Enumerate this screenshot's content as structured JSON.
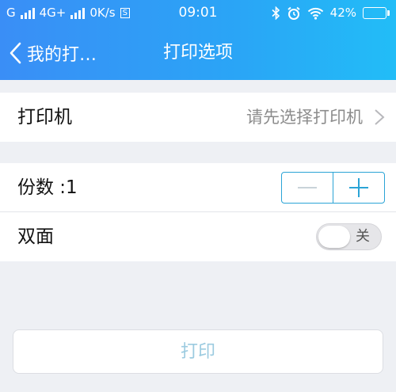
{
  "status_bar": {
    "carrier1": "G",
    "carrier2": "4G+",
    "net_speed": "0K/s",
    "s_badge": "S",
    "time": "09:01",
    "battery_percent": "42%",
    "battery_level": 0.42,
    "icons": [
      "signal-icon",
      "bluetooth-icon",
      "alarm-icon",
      "wifi-icon",
      "battery-icon"
    ]
  },
  "nav": {
    "back_label": "我的打…",
    "title": "打印选项"
  },
  "printer_row": {
    "label": "打印机",
    "value": "请先选择打印机"
  },
  "copies_row": {
    "label": "份数 :1"
  },
  "duplex_row": {
    "label": "双面",
    "toggle_label": "关",
    "toggle_on": false
  },
  "print_button": {
    "label": "打印"
  },
  "colors": {
    "accent": "#2ba4d6",
    "header_start": "#3a8ef6",
    "header_end": "#22bdf7",
    "disabled_text": "#9ccbe0"
  }
}
